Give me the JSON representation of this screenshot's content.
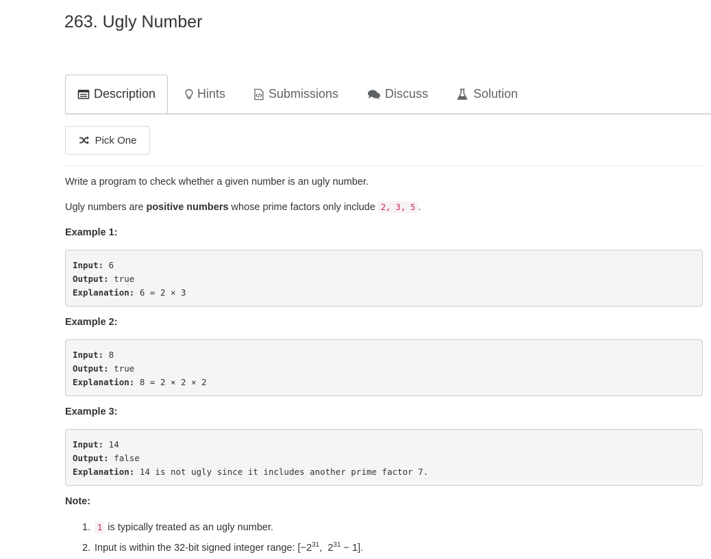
{
  "title": "263. Ugly Number",
  "tabs": [
    {
      "label": "Description",
      "icon": "description-icon",
      "active": true
    },
    {
      "label": "Hints",
      "icon": "lightbulb-icon",
      "active": false
    },
    {
      "label": "Submissions",
      "icon": "code-file-icon",
      "active": false
    },
    {
      "label": "Discuss",
      "icon": "comments-icon",
      "active": false
    },
    {
      "label": "Solution",
      "icon": "flask-icon",
      "active": false
    }
  ],
  "pick_one": {
    "label": "Pick One",
    "icon": "shuffle-icon"
  },
  "description": {
    "intro": "Write a program to check whether a given number is an ugly number.",
    "ugly_prefix": "Ugly numbers are ",
    "ugly_bold": "positive numbers",
    "ugly_middle": " whose prime factors only include ",
    "ugly_code": "2, 3, 5",
    "ugly_suffix": "."
  },
  "examples": [
    {
      "title": "Example 1:",
      "input_key": "Input:",
      "input_val": " 6",
      "output_key": "Output:",
      "output_val": " true",
      "expl_key": "Explanation:",
      "expl_val": " 6 = 2 × 3"
    },
    {
      "title": "Example 2:",
      "input_key": "Input:",
      "input_val": " 8",
      "output_key": "Output:",
      "output_val": " true",
      "expl_key": "Explanation:",
      "expl_val": " 8 = 2 × 2 × 2"
    },
    {
      "title": "Example 3:",
      "input_key": "Input:",
      "input_val": " 14",
      "output_key": "Output:",
      "output_val": " false",
      "expl_key": "Explanation:",
      "expl_val": " 14 is not ugly since it includes another prime factor 7."
    }
  ],
  "note": {
    "title": "Note:",
    "item1_num": "1.",
    "item1_code": "1",
    "item1_text": " is typically treated as an ugly number.",
    "item2_num": "2.",
    "item2_text_a": "Input is within the 32-bit signed integer range: [−2",
    "item2_sup_a": "31",
    "item2_text_b": ",  2",
    "item2_sup_b": "31",
    "item2_text_c": " − 1]."
  },
  "colors": {
    "code_inline": "#c7254e",
    "code_bg": "#f9f2f4",
    "pre_bg": "#f5f5f5"
  }
}
